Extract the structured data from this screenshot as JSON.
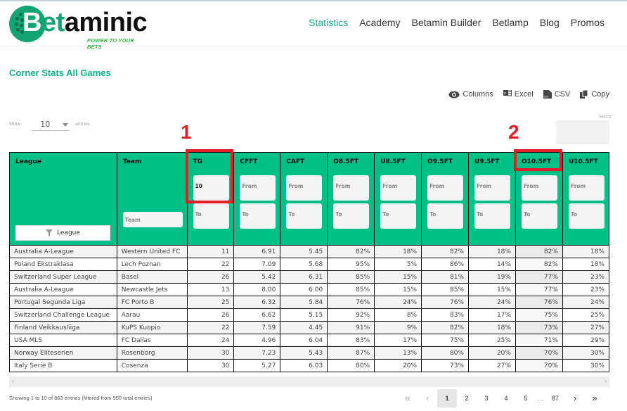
{
  "brand": {
    "logo_b": "B",
    "logo_et": "et",
    "logo_rest": "aminic",
    "tagline": "POWER TO YOUR BETS",
    "accent": "#12b38a",
    "table_header_bg": "#00bf87"
  },
  "nav": {
    "items": [
      {
        "label": "Statistics",
        "active": true
      },
      {
        "label": "Academy",
        "active": false
      },
      {
        "label": "Betamin Builder",
        "active": false
      },
      {
        "label": "Betlamp",
        "active": false
      },
      {
        "label": "Blog",
        "active": false
      },
      {
        "label": "Promos",
        "active": false
      }
    ]
  },
  "page": {
    "title": "Corner Stats All Games"
  },
  "toolbar": {
    "columns": "Columns",
    "excel": "Excel",
    "csv": "CSV",
    "copy": "Copy"
  },
  "length_menu": {
    "show": "Show",
    "value": "10",
    "entries": "entries"
  },
  "search": {
    "label": "Search:",
    "value": ""
  },
  "annotations": {
    "marker1": "1",
    "marker2": "2"
  },
  "table": {
    "columns": [
      "League",
      "Team",
      "TG",
      "CFFT",
      "CAFT",
      "O8.5FT",
      "U8.5FT",
      "O9.5FT",
      "U9.5FT",
      "O10.5FT",
      "U10.5FT"
    ],
    "filters": {
      "league_button": "League",
      "team_placeholder": "Team",
      "from_placeholder": "From",
      "to_placeholder": "To",
      "tg_from_value": "10"
    },
    "rows": [
      [
        "Australia A-League",
        "Western United FC",
        "11",
        "6.91",
        "5.45",
        "82%",
        "18%",
        "82%",
        "18%",
        "82%",
        "18%"
      ],
      [
        "Poland Ekstraklasa",
        "Lech Poznan",
        "22",
        "7.09",
        "5.68",
        "95%",
        "5%",
        "86%",
        "14%",
        "82%",
        "18%"
      ],
      [
        "Switzerland Super League",
        "Basel",
        "26",
        "5.42",
        "6.31",
        "85%",
        "15%",
        "81%",
        "19%",
        "77%",
        "23%"
      ],
      [
        "Australia A-League",
        "Newcastle Jets",
        "13",
        "8.00",
        "6.00",
        "85%",
        "15%",
        "85%",
        "15%",
        "77%",
        "23%"
      ],
      [
        "Portugal Segunda Liga",
        "FC Porto B",
        "25",
        "6.32",
        "5.84",
        "76%",
        "24%",
        "76%",
        "24%",
        "76%",
        "24%"
      ],
      [
        "Switzerland Challenge League",
        "Aarau",
        "26",
        "6.62",
        "5.15",
        "92%",
        "8%",
        "83%",
        "17%",
        "75%",
        "25%"
      ],
      [
        "Finland Veikkausliiga",
        "KuPS Kuopio",
        "22",
        "7.59",
        "4.45",
        "91%",
        "9%",
        "82%",
        "18%",
        "73%",
        "27%"
      ],
      [
        "USA MLS",
        "FC Dallas",
        "24",
        "4.96",
        "6.04",
        "83%",
        "17%",
        "75%",
        "25%",
        "71%",
        "29%"
      ],
      [
        "Norway Eliteserien",
        "Rosenborg",
        "30",
        "7.23",
        "5.43",
        "87%",
        "13%",
        "80%",
        "20%",
        "70%",
        "30%"
      ],
      [
        "Italy Serie B",
        "Cosenza",
        "30",
        "5.27",
        "6.03",
        "80%",
        "20%",
        "73%",
        "27%",
        "70%",
        "30%"
      ]
    ]
  },
  "footer": {
    "info": "Showing 1 to 10 of 863 entries (filtered from 950 total entries)",
    "pagination": {
      "first": "«",
      "prev": "‹",
      "pages": [
        "1",
        "2",
        "3",
        "4",
        "5"
      ],
      "ellipsis": "…",
      "last_page": "87",
      "next": "›",
      "last": "»",
      "current": "1"
    }
  }
}
